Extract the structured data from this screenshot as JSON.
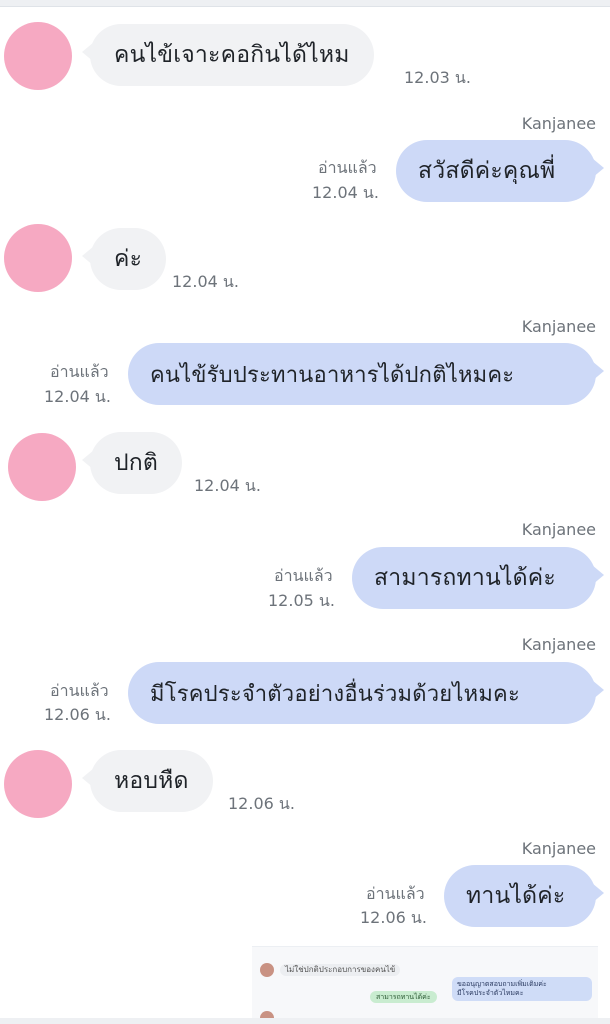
{
  "sender_name": "Kanjanee",
  "read_label": "อ่านแล้ว",
  "messages": [
    {
      "text": "คนไข้เจาะคอกินได้ไหม",
      "time": "12.03 น."
    },
    {
      "text": "สวัสดีค่ะคุณพี่",
      "time": "12.04 น."
    },
    {
      "text": "ค่ะ",
      "time": "12.04 น."
    },
    {
      "text": "คนไข้รับประทานอาหารได้ปกติไหมคะ",
      "time": "12.04 น."
    },
    {
      "text": "ปกติ",
      "time": "12.04 น."
    },
    {
      "text": "สามารถทานได้ค่ะ",
      "time": "12.05 น."
    },
    {
      "text": "มีโรคประจำตัวอย่างอื่นร่วมด้วยไหมคะ",
      "time": "12.06 น."
    },
    {
      "text": "หอบหืด",
      "time": "12.06 น."
    },
    {
      "text": "ทานได้ค่ะ",
      "time": "12.06 น."
    }
  ],
  "preview": {
    "line1": "ไม่ใช่ปกติประกอบการของคนไข้",
    "pill1": "สามารถทานได้ค่ะ",
    "blue_line1": "ขออนุญาตสอบถามเพิ่มเติมค่ะ",
    "blue_line2": "มีโรคประจำตัวไหมคะ"
  },
  "colors": {
    "incoming_bubble": "#f1f2f4",
    "outgoing_bubble": "#cdd9f7",
    "avatar": "#f6a9c2",
    "meta_text": "#6d737a"
  }
}
